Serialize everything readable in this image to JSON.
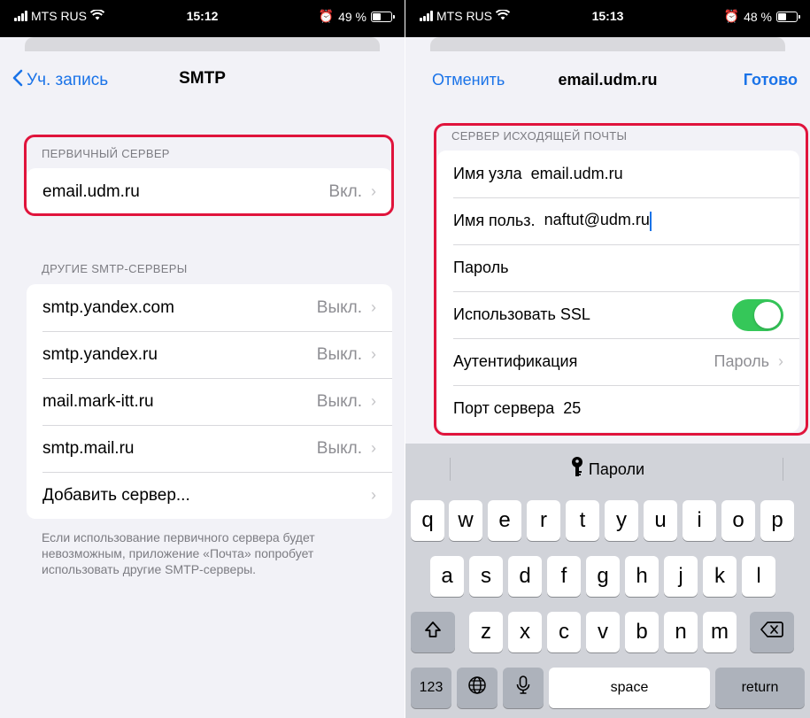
{
  "left": {
    "status": {
      "carrier": "MTS RUS",
      "time": "15:12",
      "battery": "49 %",
      "battery_level": 0.49
    },
    "nav": {
      "back_label": "Уч. запись",
      "title": "SMTP"
    },
    "primary": {
      "header": "ПЕРВИЧНЫЙ СЕРВЕР",
      "server": {
        "name": "email.udm.ru",
        "status": "Вкл."
      }
    },
    "others": {
      "header": "ДРУГИЕ SMTP-СЕРВЕРЫ",
      "items": [
        {
          "name": "smtp.yandex.com",
          "status": "Выкл."
        },
        {
          "name": "smtp.yandex.ru",
          "status": "Выкл."
        },
        {
          "name": "mail.mark-itt.ru",
          "status": "Выкл."
        },
        {
          "name": "smtp.mail.ru",
          "status": "Выкл."
        }
      ],
      "add_label": "Добавить сервер..."
    },
    "note": "Если использование первичного сервера будет невозможным, приложение «Почта» попробует использовать другие SMTP-серверы."
  },
  "right": {
    "status": {
      "carrier": "MTS RUS",
      "time": "15:13",
      "battery": "48 %",
      "battery_level": 0.48
    },
    "nav": {
      "cancel": "Отменить",
      "title": "email.udm.ru",
      "done": "Готово"
    },
    "section_header": "СЕРВЕР ИСХОДЯЩЕЙ ПОЧТЫ",
    "host": {
      "label": "Имя узла",
      "value": "email.udm.ru"
    },
    "user": {
      "label": "Имя польз.",
      "value": "naftut@udm.ru"
    },
    "password": {
      "label": "Пароль",
      "value": ""
    },
    "ssl": {
      "label": "Использовать SSL",
      "enabled": true
    },
    "auth": {
      "label": "Аутентификация",
      "value": "Пароль"
    },
    "port": {
      "label": "Порт сервера",
      "value": "25"
    },
    "keyboard": {
      "suggestion": "Пароли",
      "row1": [
        "q",
        "w",
        "e",
        "r",
        "t",
        "y",
        "u",
        "i",
        "o",
        "p"
      ],
      "row2": [
        "a",
        "s",
        "d",
        "f",
        "g",
        "h",
        "j",
        "k",
        "l"
      ],
      "row3": [
        "z",
        "x",
        "c",
        "v",
        "b",
        "n",
        "m"
      ],
      "numbers": "123",
      "space": "space",
      "return": "return"
    }
  }
}
